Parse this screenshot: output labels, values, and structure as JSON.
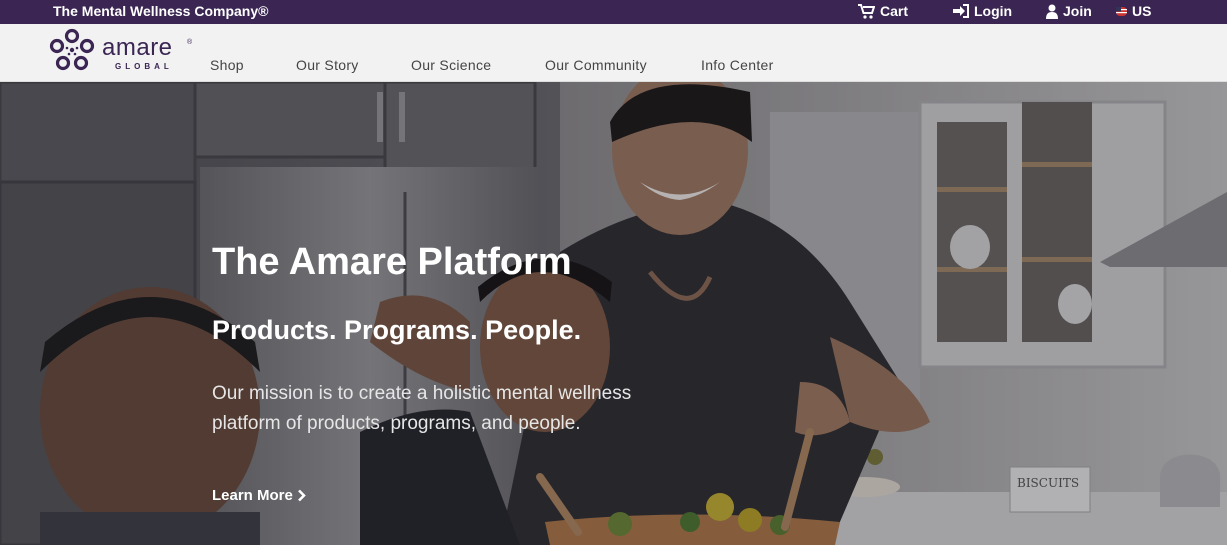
{
  "topbar": {
    "tagline": "The Mental Wellness Company®",
    "cart_label": "Cart",
    "login_label": "Login",
    "join_label": "Join",
    "region_label": "US",
    "icons": [
      "cart-icon",
      "login-icon",
      "user-icon",
      "us-flag-icon"
    ]
  },
  "nav": {
    "logo_text": "amare",
    "logo_sub": "GLOBAL",
    "logo_reg": "®",
    "items": [
      "Shop",
      "Our Story",
      "Our Science",
      "Our Community",
      "Info Center"
    ]
  },
  "hero": {
    "title": "The Amare Platform",
    "subtitle": "Products. Programs. People.",
    "body": "Our mission is to create a holistic mental wellness platform of products, programs, and people.",
    "cta": "Learn More",
    "jar_label": "BISCUITS"
  },
  "colors": {
    "brand_purple": "#3a2553",
    "nav_bg": "#f2f2f3"
  }
}
